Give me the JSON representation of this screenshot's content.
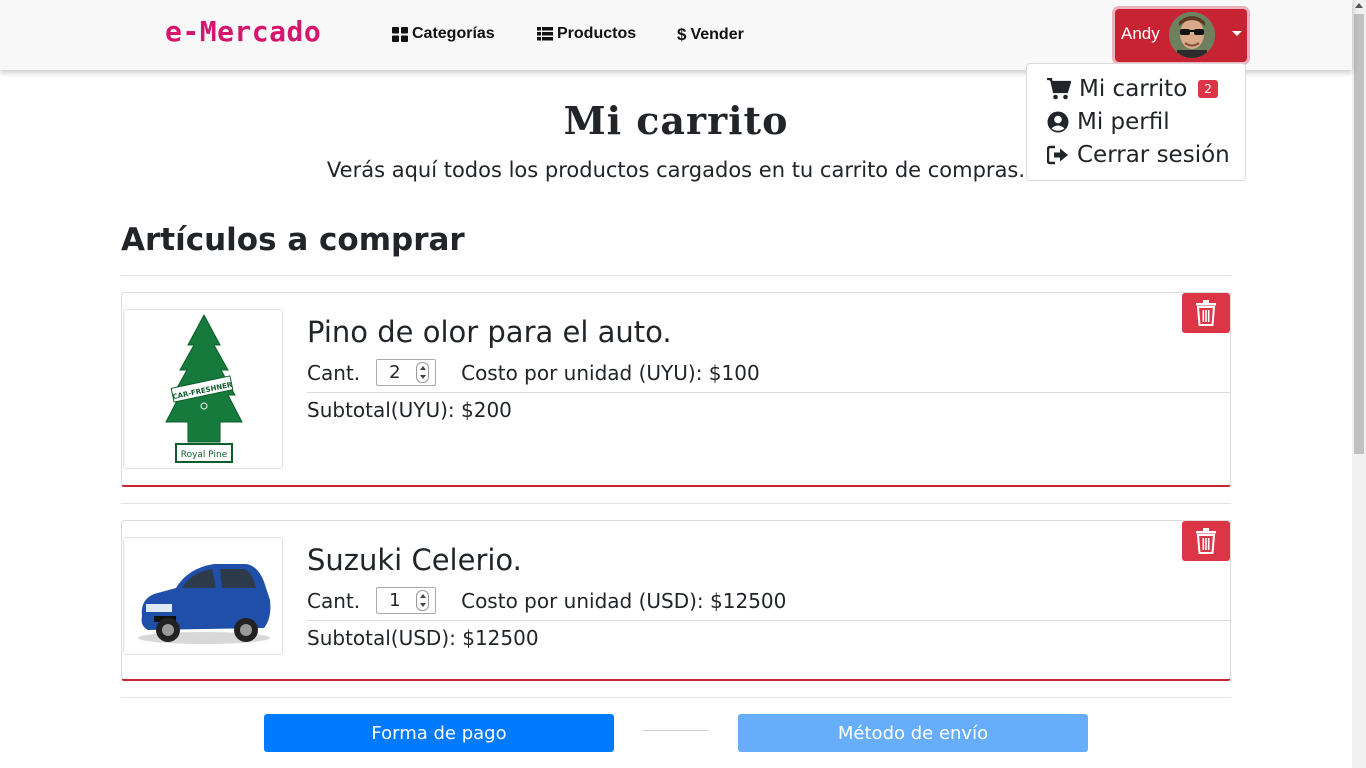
{
  "navbar": {
    "brand": "e-Mercado",
    "links": [
      {
        "label": "Categorías",
        "icon": "grid-icon"
      },
      {
        "label": "Productos",
        "icon": "list-icon"
      },
      {
        "label": "Vender",
        "icon": "dollar-icon"
      }
    ],
    "user": {
      "name": "Andy",
      "avatar": "avatar-photo"
    }
  },
  "dropdown": {
    "items": [
      {
        "label": "Mi carrito",
        "icon": "cart-icon",
        "badge": "2"
      },
      {
        "label": "Mi perfil",
        "icon": "user-circle-icon"
      },
      {
        "label": "Cerrar sesión",
        "icon": "sign-out-icon"
      }
    ]
  },
  "header": {
    "title": "Mi carrito",
    "subtitle": "Verás aquí todos los productos cargados en tu carrito de compras."
  },
  "section": {
    "title": "Artículos a comprar"
  },
  "cart": {
    "items": [
      {
        "name": "Pino de olor para el auto.",
        "qty_label": "Cant.",
        "qty": "2",
        "unit_cost": "Costo por unidad (UYU): $100",
        "subtotal": "Subtotal(UYU): $200",
        "image": "car-freshener-image"
      },
      {
        "name": "Suzuki Celerio.",
        "qty_label": "Cant.",
        "qty": "1",
        "unit_cost": "Costo por unidad (USD): $12500",
        "subtotal": "Subtotal(USD): $12500",
        "image": "blue-car-image"
      }
    ]
  },
  "actions": {
    "payment": "Forma de pago",
    "shipping": "Método de envío"
  },
  "colors": {
    "brand": "#d6166e",
    "danger": "#dc3545",
    "primary": "#007bff",
    "primary_light": "#66aefc"
  }
}
